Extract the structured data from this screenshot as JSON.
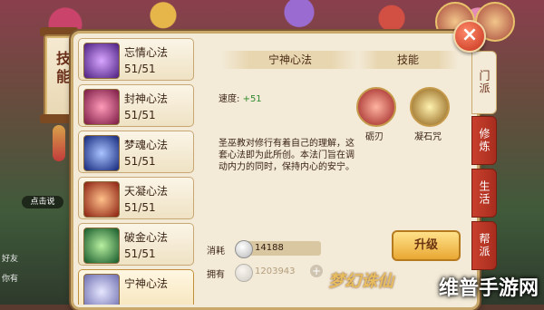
{
  "left_tab": {
    "label": "技能"
  },
  "skill_list": [
    {
      "name": "忘情心法",
      "level": "51/51",
      "color": "#7d3fb2"
    },
    {
      "name": "封神心法",
      "level": "51/51",
      "color": "#d6366e"
    },
    {
      "name": "梦魂心法",
      "level": "51/51",
      "color": "#3b5fd1"
    },
    {
      "name": "天凝心法",
      "level": "51/51",
      "color": "#d2452a"
    },
    {
      "name": "破金心法",
      "level": "51/51",
      "color": "#2f9a4a"
    },
    {
      "name": "宁神心法",
      "level": "",
      "color": "#a0a0d0"
    }
  ],
  "detail": {
    "title": "宁神心法",
    "speed_label": "速度:",
    "speed_value": "+51",
    "description": "圣巫教对修行有着自己的理解，这套心法即为此所创。本法门旨在调动内力的同时，保持内心的安宁。"
  },
  "skills_panel": {
    "title": "技能",
    "abilities": [
      {
        "name": "砺刃",
        "icon": "fist-icon"
      },
      {
        "name": "凝石咒",
        "icon": "stone-curse-icon"
      }
    ]
  },
  "cost": {
    "consume_label": "消耗",
    "consume_value": "14188",
    "own_label": "拥有",
    "own_value": "1203943"
  },
  "upgrade_button": "升级",
  "side_tabs": [
    "门派",
    "修炼",
    "生活",
    "帮派"
  ],
  "chat": {
    "bubble": "点击说",
    "label_1": "你有",
    "label_2": "好友"
  },
  "watermark": "维普手游网",
  "logo": "梦幻诛仙"
}
